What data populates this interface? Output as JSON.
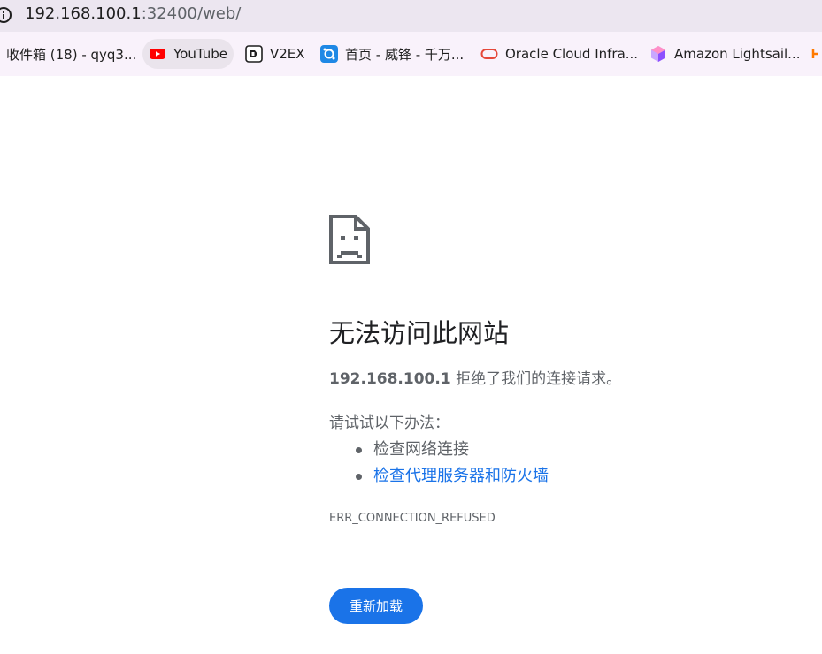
{
  "address_bar": {
    "host": "192.168.100.1",
    "path": ":32400/web/",
    "icon": "site-info-icon"
  },
  "bookmarks": [
    {
      "label": "收件箱 (18) - qyq3...",
      "icon": ""
    },
    {
      "label": "YouTube",
      "icon": "youtube-icon",
      "color": "#ff0000"
    },
    {
      "label": "V2EX",
      "icon": "v2ex-icon",
      "color": "#1f1f1f"
    },
    {
      "label": "首页 - 威锋 - 千万...",
      "icon": "feng-icon",
      "color": "#1e88e5"
    },
    {
      "label": "Oracle Cloud Infra...",
      "icon": "oracle-icon",
      "color": "#e5483a"
    },
    {
      "label": "Amazon Lightsail...",
      "icon": "lightsail-icon",
      "color": "#8c4fff"
    },
    {
      "label": "",
      "icon": "bookmark-overflow-icon",
      "color": "#ff7a00"
    }
  ],
  "error": {
    "icon": "sad-page-icon",
    "title": "无法访问此网站",
    "host": "192.168.100.1",
    "message": " 拒绝了我们的连接请求。",
    "suggest_heading": "请试试以下办法：",
    "suggestions": [
      "检查网络连接",
      "检查代理服务器和防火墙"
    ],
    "code": "ERR_CONNECTION_REFUSED",
    "reload_label": "重新加载"
  },
  "colors": {
    "accent": "#1a73e8",
    "topbar": "#ece6f0",
    "bookmark_bar": "#f9f2fb"
  }
}
